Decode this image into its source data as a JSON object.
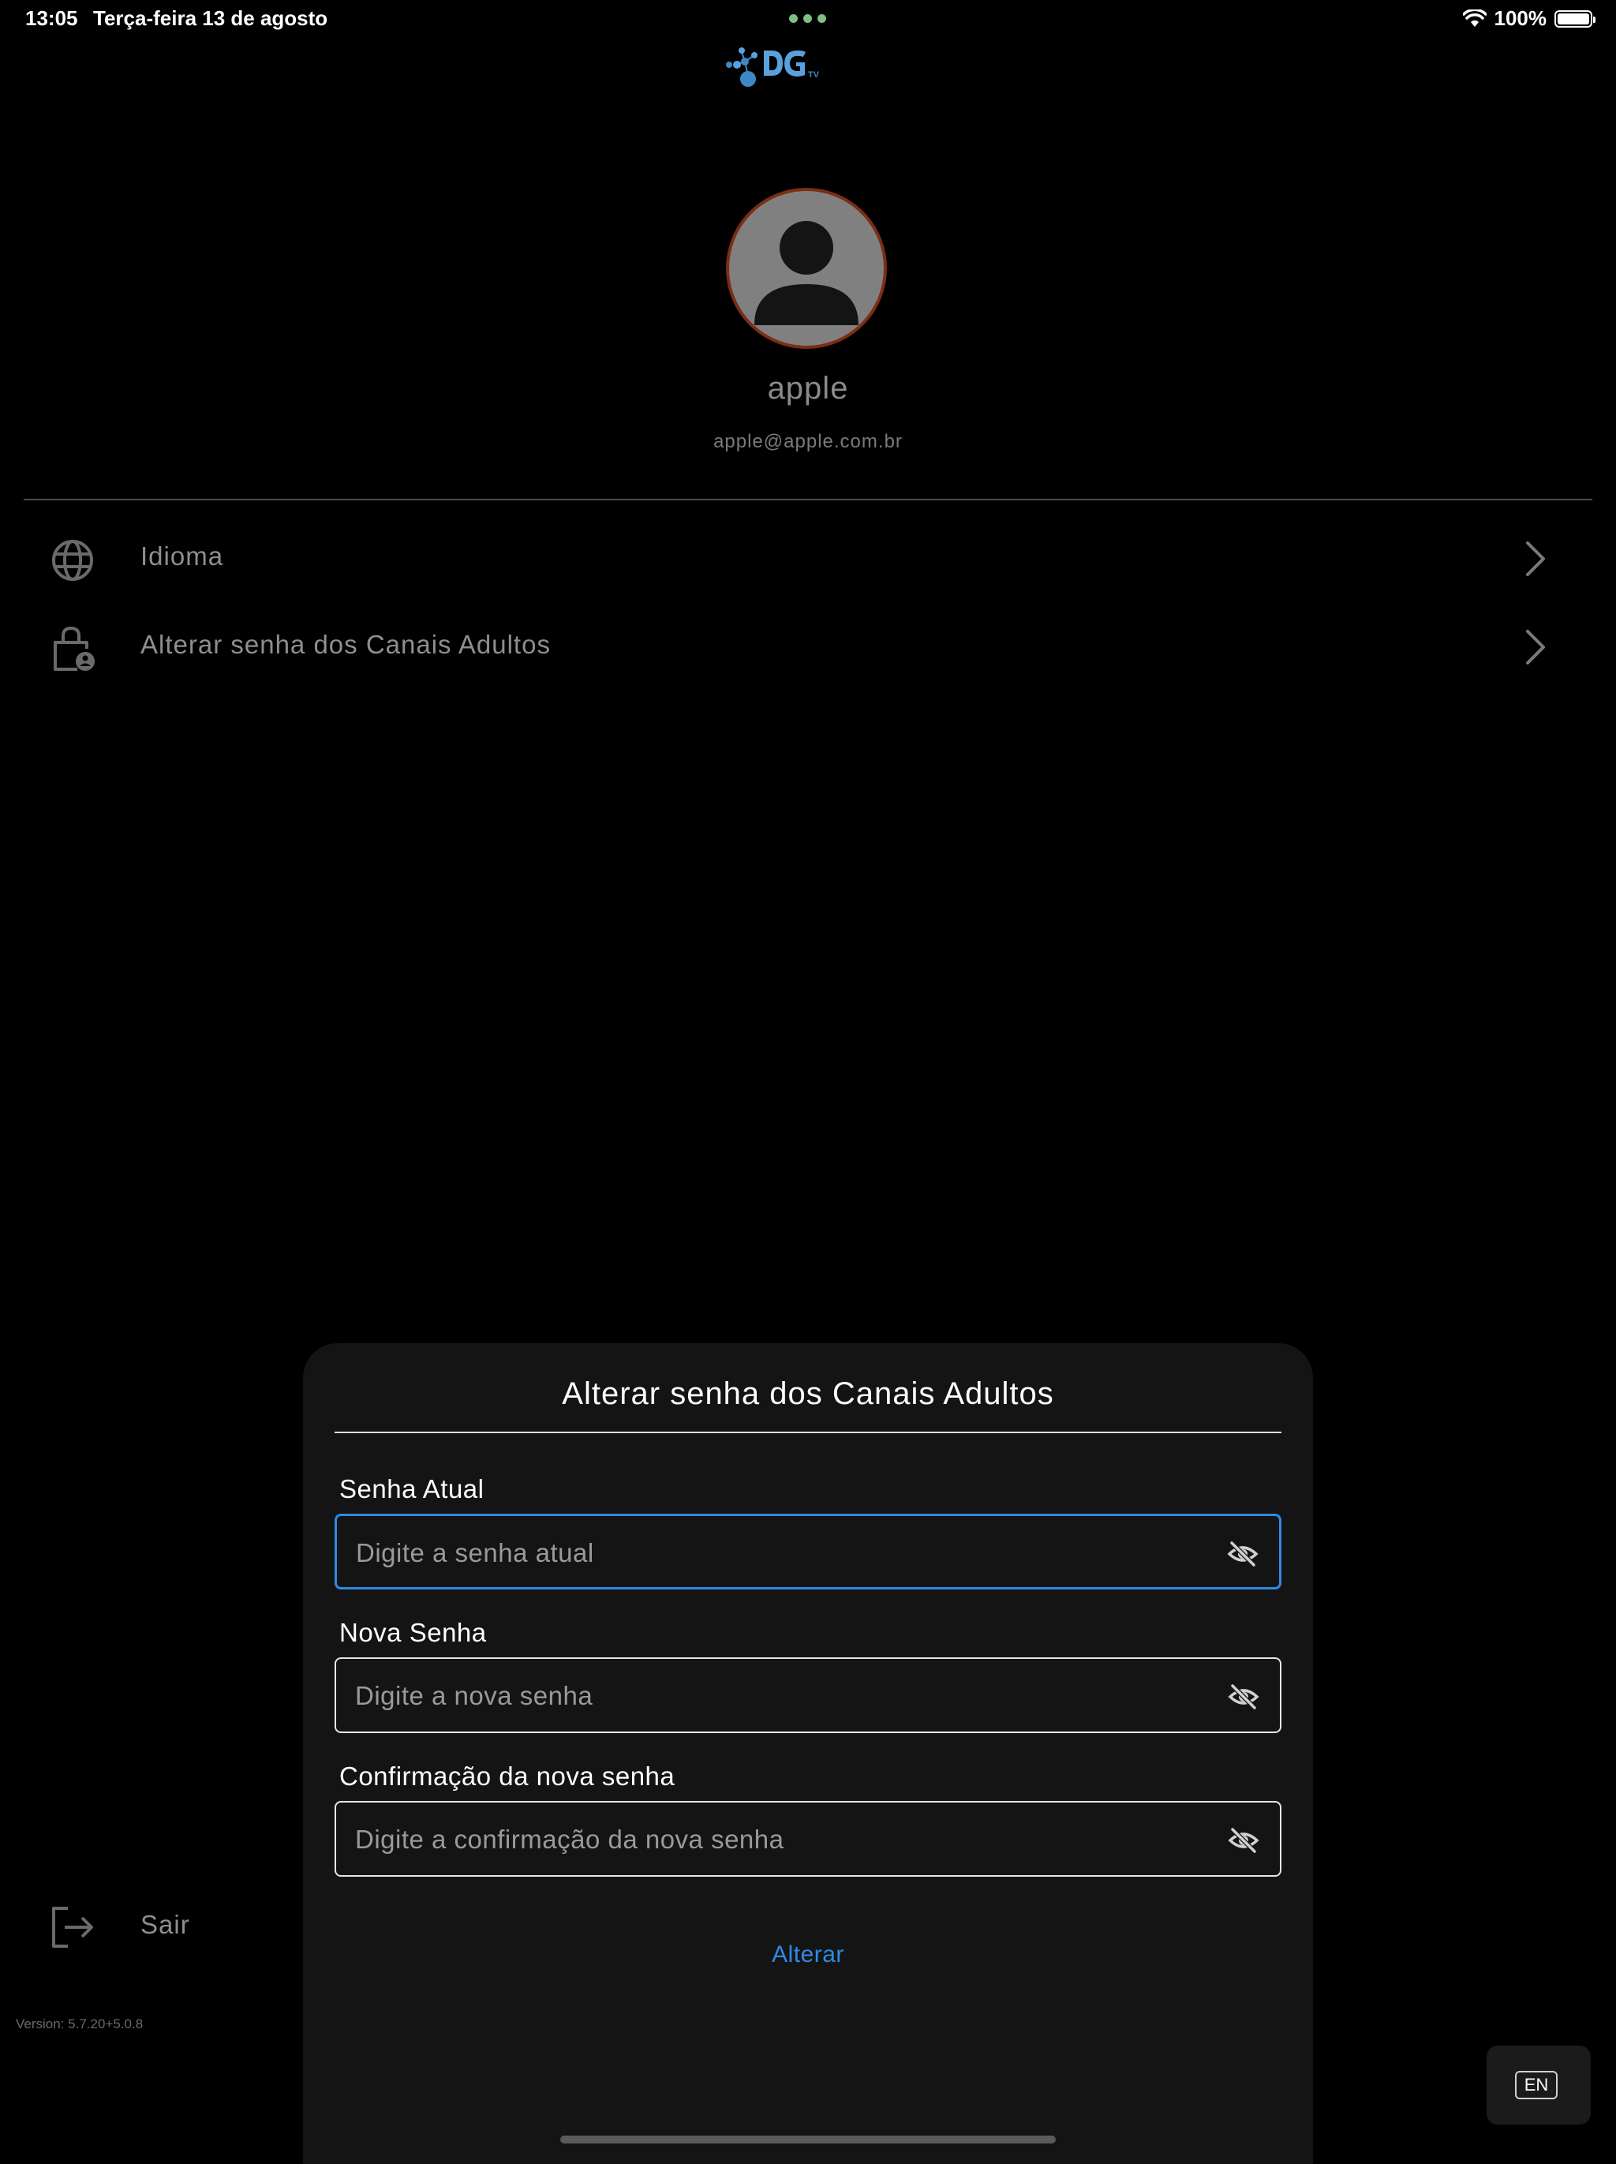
{
  "status_bar": {
    "time": "13:05",
    "date": "Terça-feira 13 de agosto",
    "battery": "100%"
  },
  "profile": {
    "name": "apple",
    "email": "apple@apple.com.br"
  },
  "menu": {
    "items": [
      {
        "label": "Idioma",
        "icon": "globe-icon"
      },
      {
        "label": "Alterar senha dos Canais Adultos",
        "icon": "lock-icon"
      }
    ]
  },
  "logout": {
    "label": "Sair",
    "icon": "logout-icon"
  },
  "version": "Version: 5.7.20+5.0.8",
  "modal": {
    "title": "Alterar senha dos Canais Adultos",
    "fields": [
      {
        "label": "Senha Atual",
        "placeholder": "Digite a senha atual",
        "value": ""
      },
      {
        "label": "Nova Senha",
        "placeholder": "Digite a nova senha",
        "value": ""
      },
      {
        "label": "Confirmação da nova senha",
        "placeholder": "Digite a confirmação da nova senha",
        "value": ""
      }
    ],
    "submit_label": "Alterar"
  },
  "language_badge": "EN",
  "colors": {
    "accent": "#2f8ae5",
    "background": "#000000",
    "modal_background": "#141414",
    "avatar_border": "#7a2e15"
  }
}
